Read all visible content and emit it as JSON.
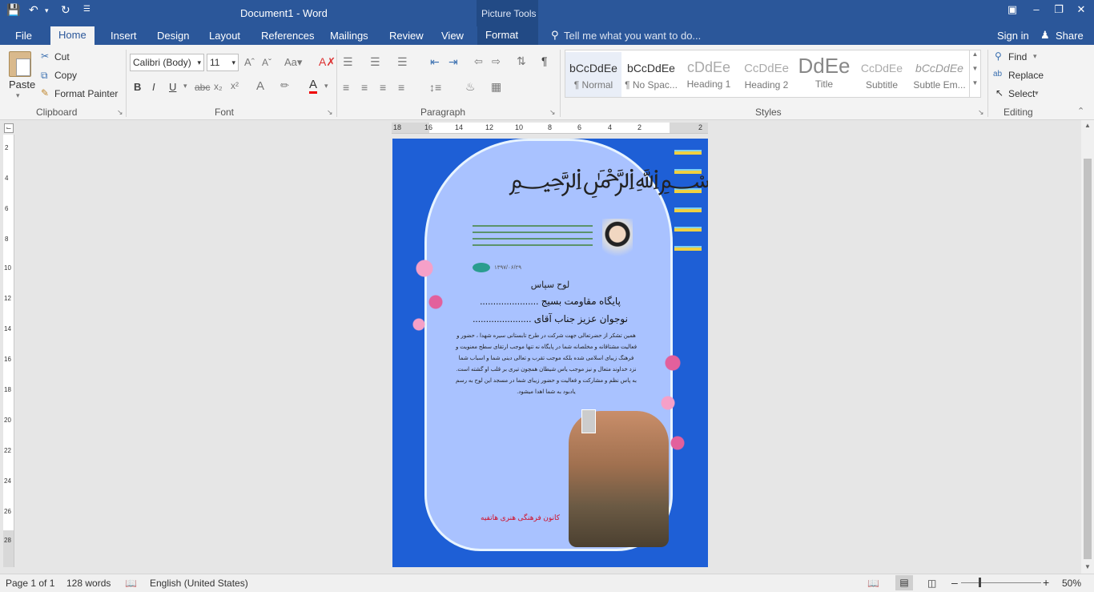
{
  "window": {
    "title": "Document1 - Word",
    "context_tab_group": "Picture Tools"
  },
  "tabs": [
    {
      "label": "File"
    },
    {
      "label": "Home"
    },
    {
      "label": "Insert"
    },
    {
      "label": "Design"
    },
    {
      "label": "Layout"
    },
    {
      "label": "References"
    },
    {
      "label": "Mailings"
    },
    {
      "label": "Review"
    },
    {
      "label": "View"
    },
    {
      "label": "Format"
    }
  ],
  "tell_me": "Tell me what you want to do...",
  "account": {
    "sign_in": "Sign in",
    "share": "Share"
  },
  "clipboard": {
    "paste": "Paste",
    "cut": "Cut",
    "copy": "Copy",
    "format_painter": "Format Painter",
    "group": "Clipboard"
  },
  "font": {
    "name": "Calibri (Body)",
    "size": "11",
    "group": "Font"
  },
  "paragraph": {
    "group": "Paragraph"
  },
  "styles": {
    "group": "Styles",
    "items": [
      {
        "preview": "bCcDdEe",
        "name": "¶ Normal"
      },
      {
        "preview": "bCcDdEe",
        "name": "¶ No Spac..."
      },
      {
        "preview": "cDdEe",
        "name": "Heading 1"
      },
      {
        "preview": "CcDdEe",
        "name": "Heading 2"
      },
      {
        "preview": "DdEe",
        "name": "Title"
      },
      {
        "preview": "CcDdEe",
        "name": "Subtitle"
      },
      {
        "preview": "bCcDdEe",
        "name": "Subtle Em..."
      }
    ]
  },
  "editing": {
    "find": "Find",
    "replace": "Replace",
    "select": "Select",
    "group": "Editing"
  },
  "ruler": {
    "h_ticks": [
      "18",
      "16",
      "14",
      "12",
      "10",
      "8",
      "6",
      "4",
      "2",
      "2"
    ],
    "v_ticks": [
      "2",
      "4",
      "6",
      "8",
      "10",
      "12",
      "14",
      "16",
      "18",
      "20",
      "22",
      "24",
      "26",
      "28"
    ]
  },
  "document": {
    "heading": "لوح سپاس",
    "line1": "پایگاه مقاومت بسیج ......................",
    "line2": "نوجوان عزیز جناب آقای ......................",
    "body": [
      "همین تشکر از حضرتعالی جهت شرکت در طرح تابستانی سیره شهدا ، حضور و",
      "فعالیت مشتاقانه و مخلصانه شما در  پایگاه نه تنها موجب ارتقای سطح معنویت و",
      "فرهنگ  زیبای اسلامی شده بلکه موجب تقرب و تعالی دینی شما و اسباب شما",
      "نزد خداوند متعال و نیز موجب یاس شیطان همچون تیری بر قلب او گشته است.",
      "به پاس نظم و مشارکت و فعالیت و حضور زیبای شما در مسجد این لوح به رسم",
      "یادبود به شما اهدا میشود."
    ],
    "footer": "کانون فرهنگی هنری هاتفیه",
    "date": "۱۳۹۷/۰۶/۲۹"
  },
  "status": {
    "page": "Page 1 of 1",
    "words": "128 words",
    "language": "English (United States)",
    "zoom": "50%"
  }
}
